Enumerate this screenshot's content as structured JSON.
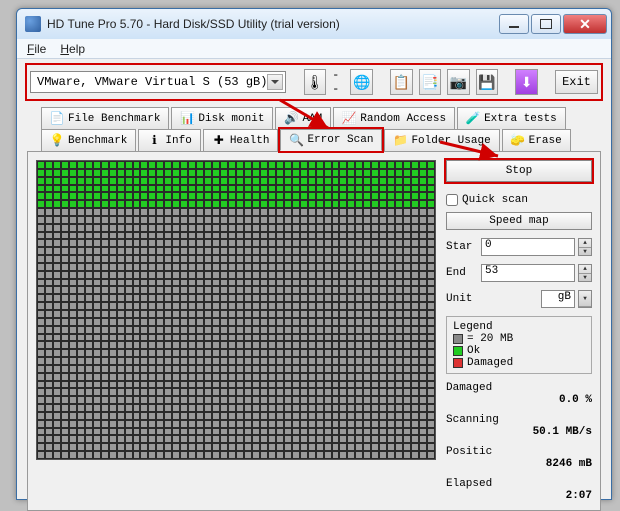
{
  "window": {
    "title": "HD Tune Pro 5.70 - Hard Disk/SSD Utility (trial version)"
  },
  "menu": {
    "file": "File",
    "help": "Help"
  },
  "toolbar": {
    "drive_selection": "VMware, VMware Virtual S (53 gB)",
    "exit": "Exit"
  },
  "tabs_top": [
    {
      "label": "File Benchmark",
      "icon": "📄"
    },
    {
      "label": "Disk monit",
      "icon": "📊"
    },
    {
      "label": "AAM",
      "icon": "🔊"
    },
    {
      "label": "Random Access",
      "icon": "📈"
    },
    {
      "label": "Extra tests",
      "icon": "🧪"
    }
  ],
  "tabs_bottom": [
    {
      "label": "Benchmark",
      "icon": "💡"
    },
    {
      "label": "Info",
      "icon": "ℹ"
    },
    {
      "label": "Health",
      "icon": "✚"
    },
    {
      "label": "Error Scan",
      "icon": "🔍"
    },
    {
      "label": "Folder Usage",
      "icon": "📁"
    },
    {
      "label": "Erase",
      "icon": "🧽"
    }
  ],
  "panel": {
    "stop": "Stop",
    "quick_scan": "Quick scan",
    "speed_map": "Speed map",
    "star_label": "Star",
    "star_value": "0",
    "end_label": "End",
    "end_value": "53",
    "unit_label": "Unit",
    "unit_value": "gB",
    "legend_title": "Legend",
    "legend_block": "= 20 MB",
    "legend_ok": "Ok",
    "legend_dmg": "Damaged",
    "damaged_label": "Damaged",
    "damaged_value": "0.0 %",
    "scanning_label": "Scanning",
    "scanning_value": "50.1 MB/s",
    "position_label": "Positic",
    "position_value": "8246 mB",
    "elapsed_label": "Elapsed",
    "elapsed_value": "2:07"
  },
  "scan": {
    "total_cols": 50,
    "total_rows": 38,
    "ok_rows": 6
  }
}
